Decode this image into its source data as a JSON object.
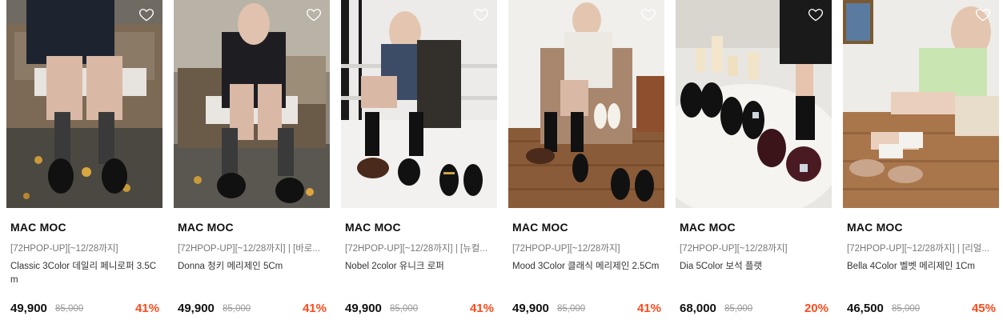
{
  "products": [
    {
      "brand": "MAC MOC",
      "promo": "[72HPOP-UP][~12/28까지]",
      "name": "Classic 3Color 데일리 페니로퍼 3.5Cm",
      "price": "49,900",
      "original_price": "85,000",
      "discount": "41%",
      "wishlist_icon": "heart-outline-icon"
    },
    {
      "brand": "MAC MOC",
      "promo": "[72HPOP-UP][~12/28까지] | [바로...",
      "name": "Donna 청키 메리제인 5Cm",
      "price": "49,900",
      "original_price": "85,000",
      "discount": "41%",
      "wishlist_icon": "heart-outline-icon"
    },
    {
      "brand": "MAC MOC",
      "promo": "[72HPOP-UP][~12/28까지] | [뉴컬...",
      "name": "Nobel 2color 유니크 로퍼",
      "price": "49,900",
      "original_price": "85,000",
      "discount": "41%",
      "wishlist_icon": "heart-outline-icon"
    },
    {
      "brand": "MAC MOC",
      "promo": "[72HPOP-UP][~12/28까지]",
      "name": "Mood 3Color 클래식 메리제인 2.5Cm",
      "price": "49,900",
      "original_price": "85,000",
      "discount": "41%",
      "wishlist_icon": "heart-outline-icon"
    },
    {
      "brand": "MAC MOC",
      "promo": "[72HPOP-UP][~12/28까지]",
      "name": "Dia 5Color 보석 플랫",
      "price": "68,000",
      "original_price": "85,000",
      "discount": "20%",
      "wishlist_icon": "heart-outline-icon"
    },
    {
      "brand": "MAC MOC",
      "promo": "[72HPOP-UP][~12/28까지] | [리얼...",
      "name": "Bella 4Color 벨벳 메리제인 1Cm",
      "price": "46,500",
      "original_price": "85,000",
      "discount": "45%",
      "wishlist_icon": "heart-outline-icon"
    }
  ],
  "colors": {
    "discount": "#ff4a1c",
    "brand_text": "#111111",
    "promo_text": "#777777",
    "original_price": "#999999"
  }
}
